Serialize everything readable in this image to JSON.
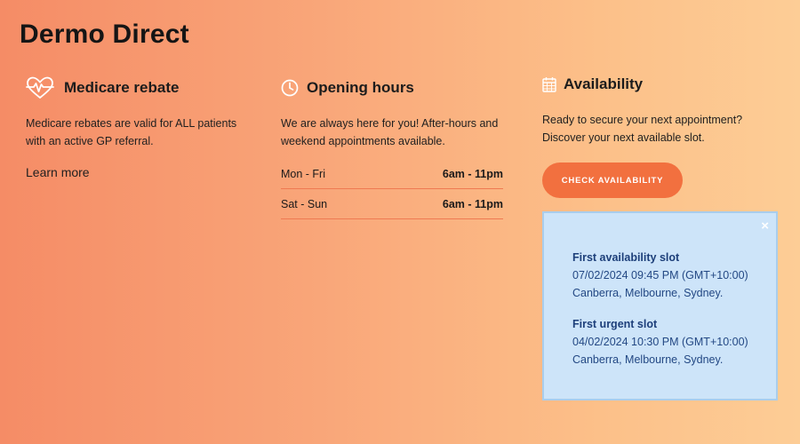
{
  "brand": "Dermo Direct",
  "medicare": {
    "icon": "heart-pulse-icon",
    "title": "Medicare rebate",
    "text": "Medicare rebates are valid for ALL patients with an active GP referral.",
    "link": "Learn more"
  },
  "hours": {
    "icon": "clock-icon",
    "title": "Opening hours",
    "text": "We are always here for you! After-hours and weekend appointments available.",
    "rows": [
      {
        "days": "Mon - Fri",
        "time": "6am - 11pm"
      },
      {
        "days": "Sat - Sun",
        "time": "6am - 11pm"
      }
    ]
  },
  "availability": {
    "icon": "calendar-icon",
    "title": "Availability",
    "text": "Ready to secure your next appointment? Discover your next available slot.",
    "button": "CHECK AVAILABILITY"
  },
  "slots": {
    "close": "×",
    "first": {
      "title": "First availability slot",
      "datetime": "07/02/2024 09:45 PM (GMT+10:00)",
      "location": "Canberra, Melbourne, Sydney."
    },
    "urgent": {
      "title": "First urgent slot",
      "datetime": "04/02/2024 10:30 PM (GMT+10:00)",
      "location": "Canberra, Melbourne, Sydney."
    }
  },
  "colors": {
    "accent": "#f2703f",
    "panel_bg": "#cde4f9",
    "panel_text": "#1d3f7a"
  }
}
